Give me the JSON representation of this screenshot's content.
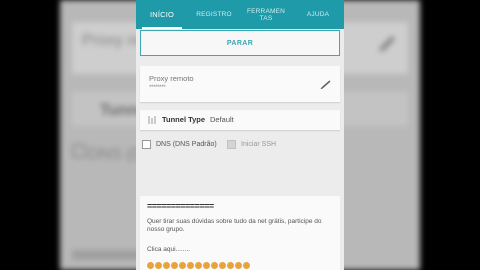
{
  "background": {
    "proxy_text": "Proxy re",
    "tunnel_text": "Tunnel",
    "dns_text": "DNS (D"
  },
  "tabs": [
    {
      "label": "INÍCIO",
      "active": true
    },
    {
      "label": "REGISTRO",
      "active": false
    },
    {
      "label": "FERRAMEN TAS",
      "active": false
    },
    {
      "label": "AJUDA",
      "active": false
    }
  ],
  "main": {
    "stop_button": "PARAR",
    "proxy": {
      "label": "Proxy remoto",
      "value": "********"
    },
    "tunnel": {
      "label": "Tunnel Type",
      "value": "Default"
    },
    "checks": [
      {
        "label": "DNS (DNS Padrão)",
        "checked": false,
        "disabled": false
      },
      {
        "label": "Iniciar SSH",
        "checked": false,
        "disabled": true
      }
    ],
    "message": {
      "separator": "==============",
      "body": "Quer tirar suas dúvidas sobre tudo da net grátis, participe do nosso grupo.",
      "click": "Clica aqui........"
    }
  },
  "colors": {
    "accent": "#1e9aa8",
    "emoji": "#e8a33d"
  }
}
